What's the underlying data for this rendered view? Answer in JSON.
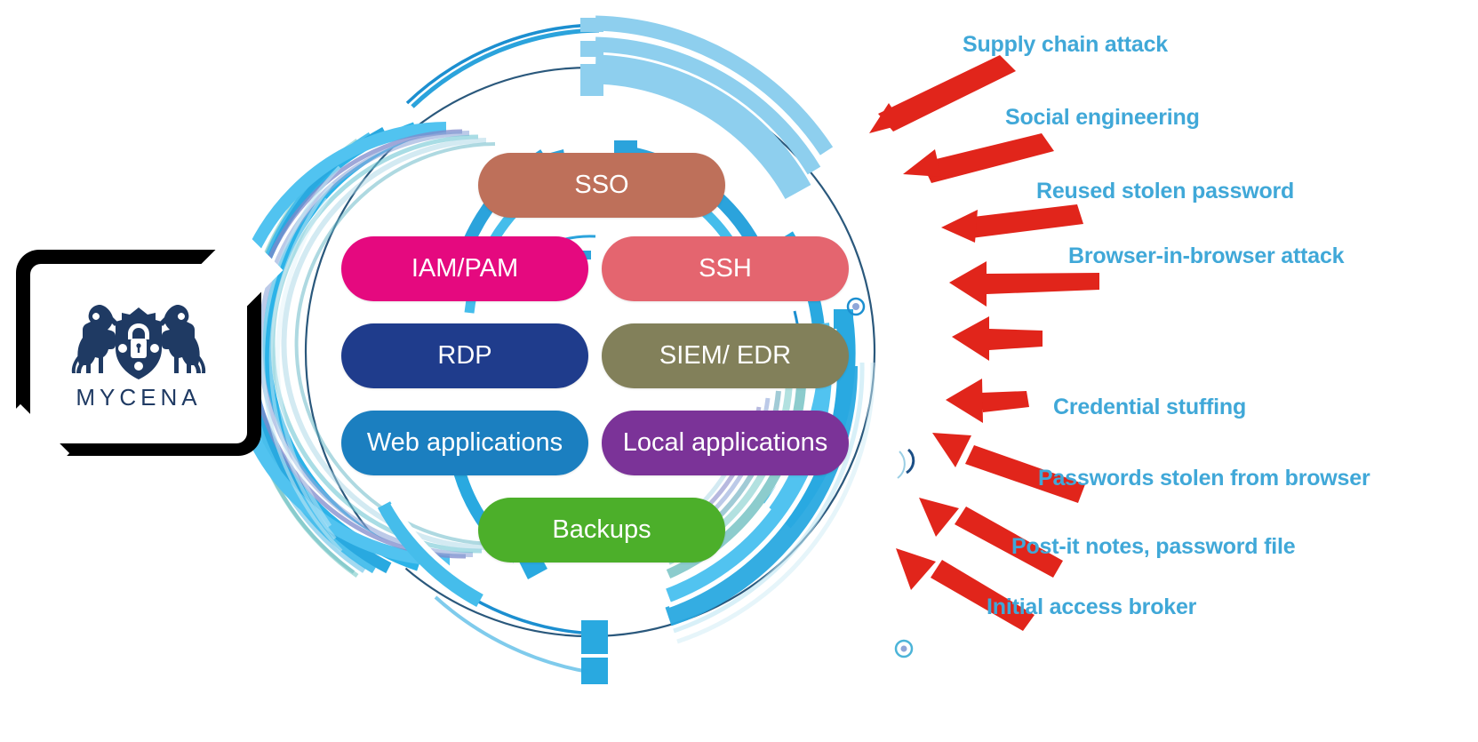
{
  "logo": {
    "wordmark": "MYCENA",
    "crest_icon": "lion-shield-lock-crest-icon",
    "device_icon": "tablet-device-icon"
  },
  "colors": {
    "label_blue": "#40A8D8",
    "arrow_red": "#E1251B",
    "ribbon_light_blue": "#8ECFEE",
    "ribbon_blue": "#29A9E0",
    "ribbon_mid_blue": "#1C8FD0",
    "ribbon_teal": "#7FC7C8",
    "ribbon_violet": "#7B7FC4",
    "logo_navy": "#1F3A63"
  },
  "pills": [
    {
      "id": "sso",
      "label": "SSO",
      "color": "#BE705A"
    },
    {
      "id": "iam",
      "label": "IAM/PAM",
      "color": "#E5097F"
    },
    {
      "id": "ssh",
      "label": "SSH",
      "color": "#E4656F"
    },
    {
      "id": "rdp",
      "label": "RDP",
      "color": "#1F3C8C"
    },
    {
      "id": "siem",
      "label": "SIEM/ EDR",
      "color": "#82805A"
    },
    {
      "id": "webapps",
      "label": "Web applications",
      "color": "#1B7FC0"
    },
    {
      "id": "localapps",
      "label": "Local applications",
      "color": "#7B3398"
    },
    {
      "id": "backups",
      "label": "Backups",
      "color": "#4CAF2A"
    }
  ],
  "attack_labels": [
    {
      "id": "supply-chain-attack",
      "label": "Supply chain attack"
    },
    {
      "id": "social-engineering",
      "label": "Social engineering"
    },
    {
      "id": "reused-stolen-password",
      "label": "Reused stolen password"
    },
    {
      "id": "browser-in-browser-attack",
      "label": "Browser-in-browser attack"
    },
    {
      "id": "credential-stuffing",
      "label": "Credential stuffing"
    },
    {
      "id": "passwords-stolen-from-browser",
      "label": "Passwords stolen from browser"
    },
    {
      "id": "post-it-notes-password-file",
      "label": "Post-it notes, password file"
    },
    {
      "id": "initial-access-broker",
      "label": "Initial access broker"
    }
  ]
}
